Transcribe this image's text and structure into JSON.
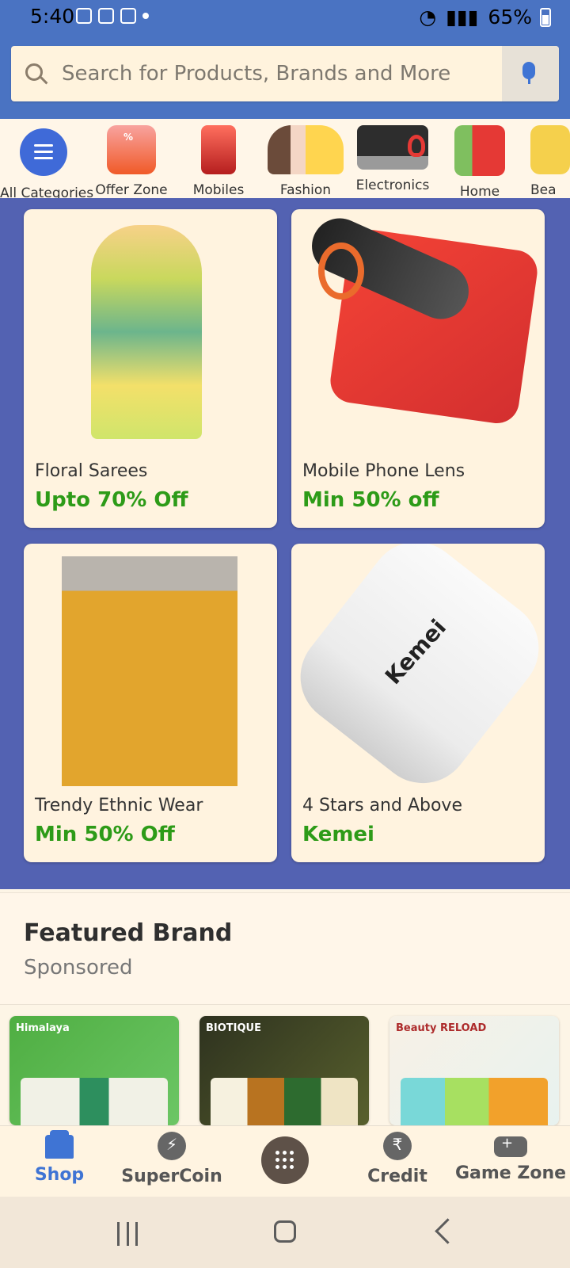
{
  "status_bar": {
    "time": "5:40",
    "battery": "65%"
  },
  "search": {
    "placeholder": "Search for Products, Brands and More"
  },
  "categories": [
    {
      "label": "All Categories",
      "icon": "menu-icon"
    },
    {
      "label": "Offer Zone",
      "icon": "gift-icon"
    },
    {
      "label": "Mobiles",
      "icon": "mobile-icon"
    },
    {
      "label": "Fashion",
      "icon": "fashion-icon"
    },
    {
      "label": "Electronics",
      "icon": "electronics-icon"
    },
    {
      "label": "Home",
      "icon": "home-icon"
    },
    {
      "label": "Bea",
      "icon": "beauty-icon"
    }
  ],
  "promotions": [
    {
      "title": "Floral Sarees",
      "subtitle": "Upto 70% Off"
    },
    {
      "title": "Mobile Phone Lens",
      "subtitle": "Min 50% off"
    },
    {
      "title": "Trendy Ethnic Wear",
      "subtitle": "Min 50% Off"
    },
    {
      "title": "4 Stars and Above",
      "subtitle": "Kemei"
    }
  ],
  "featured": {
    "title": "Featured Brand",
    "subtitle": "Sponsored",
    "brands": [
      {
        "name": "Himalaya"
      },
      {
        "name": "BIOTIQUE"
      },
      {
        "name": "Beauty RELOAD"
      }
    ]
  },
  "bottom_nav": [
    {
      "label": "Shop",
      "icon": "shop-icon",
      "active": true
    },
    {
      "label": "SuperCoin",
      "icon": "supercoin-icon",
      "active": false
    },
    {
      "label": "",
      "icon": "grid-icon",
      "active": false
    },
    {
      "label": "Credit",
      "icon": "credit-icon",
      "active": false
    },
    {
      "label": "Game Zone",
      "icon": "game-icon",
      "active": false
    }
  ],
  "colors": {
    "primary": "#4a73c2",
    "background": "#fdf5e6",
    "promo_background": "#5362b2",
    "success_text": "#2d9b18",
    "active_nav": "#3f74d4"
  }
}
